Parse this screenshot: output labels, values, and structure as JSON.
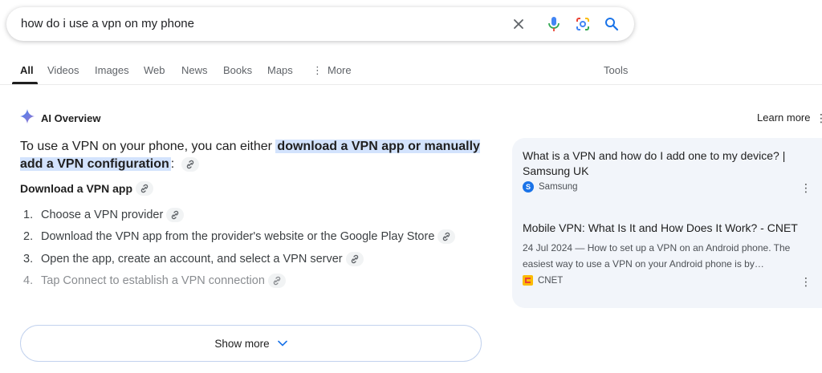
{
  "search": {
    "query": "how do i use a vpn on my phone",
    "clear_icon": "close-icon",
    "voice_icon": "microphone-icon",
    "lens_icon": "lens-icon",
    "search_icon": "search-icon"
  },
  "tabs": [
    {
      "label": "All",
      "active": true
    },
    {
      "label": "Videos"
    },
    {
      "label": "Images"
    },
    {
      "label": "Web"
    },
    {
      "label": "News"
    },
    {
      "label": "Books"
    },
    {
      "label": "Maps"
    },
    {
      "label": "More"
    }
  ],
  "tools_label": "Tools",
  "ai_overview": {
    "title": "AI Overview",
    "learn_more": "Learn more",
    "intro_prefix": "To use a VPN on your phone, you can either ",
    "intro_highlight": "download a VPN app or manually add a VPN configuration",
    "intro_suffix": ":",
    "subheading": "Download a VPN app",
    "steps": [
      {
        "num": "1.",
        "text": "Choose a VPN provider"
      },
      {
        "num": "2.",
        "text": "Download the VPN app from the provider's website or the Google Play Store"
      },
      {
        "num": "3.",
        "text": "Open the app, create an account, and select a VPN server"
      },
      {
        "num": "4.",
        "text": "Tap Connect to establish a VPN connection"
      }
    ],
    "show_more": "Show more"
  },
  "sources": [
    {
      "title": "What is a VPN and how do I add one to my device? | Samsung UK",
      "site": "Samsung",
      "favicon_letter": "S"
    },
    {
      "title": "Mobile VPN: What Is It and How Does It Work? - CNET",
      "snippet": "24 Jul 2024 — How to set up a VPN on an Android phone. The easiest way to use a VPN on your Android phone is by…",
      "site": "CNET",
      "favicon_letter": "C"
    }
  ],
  "colors": {
    "highlight": "#d3e3fd",
    "source_panel": "#f2f5fa",
    "link_blue": "#1a73e8"
  }
}
